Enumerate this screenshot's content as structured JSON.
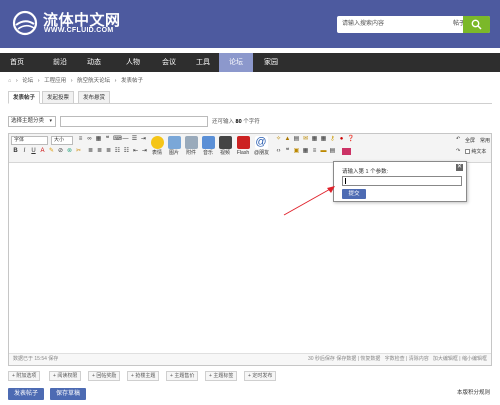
{
  "header": {
    "site_name": "流体中文网",
    "site_url": "WWW.CFLUID.COM",
    "search_placeholder": "请输入搜索内容",
    "search_scope": "帖子",
    "brand_color": "#4d5a9f",
    "search_button_color": "#7bb829"
  },
  "nav": {
    "items": [
      "首页",
      "前沿",
      "动态",
      "人物",
      "会议",
      "工具",
      "论坛",
      "家园"
    ],
    "active_index": 6
  },
  "breadcrumb": [
    "论坛",
    "工程应用",
    "航空航天论坛",
    "发表帖子"
  ],
  "tabs": [
    "发表帖子",
    "发起投票",
    "发布悬赏"
  ],
  "subject": {
    "type_select": "选择主题分类",
    "hint_prefix": "还可输入",
    "hint_count": "80",
    "hint_suffix": "个字符"
  },
  "toolbar": {
    "font_select": "字体",
    "size_select": "大小",
    "big_buttons": [
      "表情",
      "图片",
      "附件",
      "音乐",
      "视频",
      "Flash",
      "@朋友"
    ],
    "right": {
      "fullscreen": "全屏",
      "common": "常用",
      "plain_text": "纯文本"
    }
  },
  "status": {
    "left": "数据已于 15:54 保存",
    "right": [
      "30 秒后保存",
      "保存数据",
      "恢复数据",
      "字数检查",
      "清除内容",
      "加大编辑框",
      "缩小编辑框"
    ]
  },
  "popup": {
    "label": "请输入第 1 个参数:",
    "submit": "提交",
    "close": "✕"
  },
  "extras": [
    "附加选项",
    "阅读权限",
    "回帖奖励",
    "抢楼主题",
    "主题售价",
    "主题标签",
    "定时发布"
  ],
  "actions": {
    "submit": "发表帖子",
    "save_draft": "保存草稿",
    "rules": "本版积分规则"
  }
}
